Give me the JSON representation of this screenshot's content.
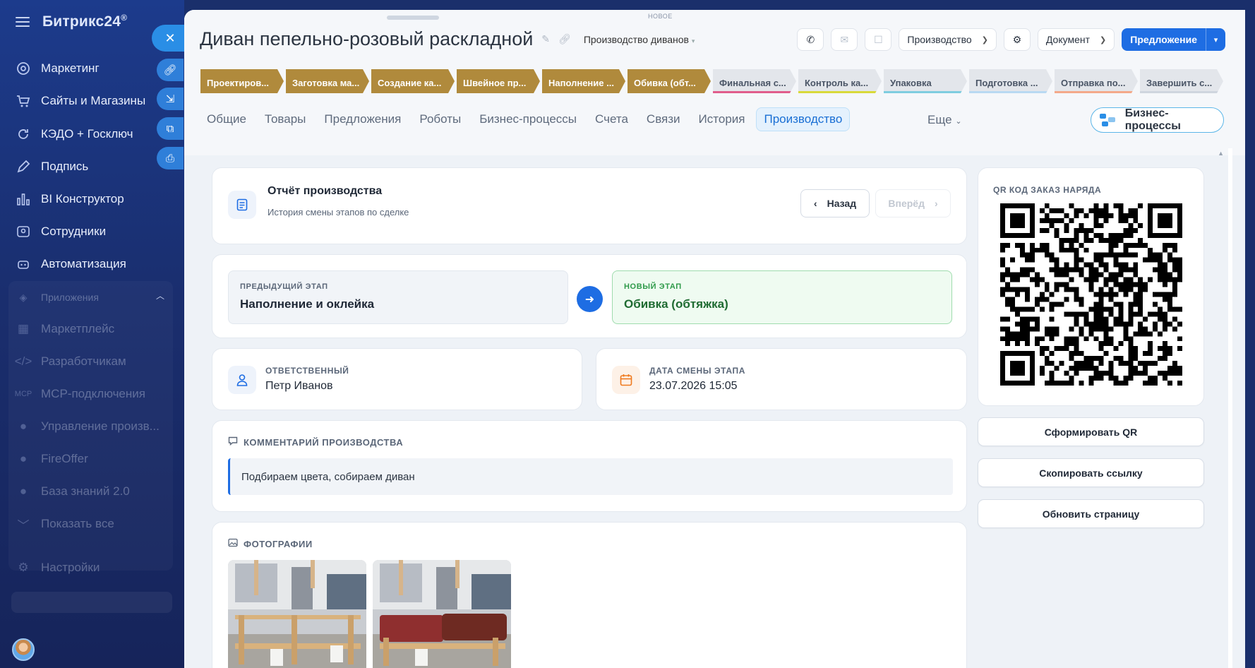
{
  "sidebar": {
    "logo": "Битрикс24",
    "logo_mark": "®",
    "items": [
      {
        "label": "Маркетинг",
        "icon": "target-icon"
      },
      {
        "label": "Сайты и Магазины",
        "icon": "cart-icon"
      },
      {
        "label": "КЭДО + Госключ",
        "icon": "refresh-icon"
      },
      {
        "label": "Подпись",
        "icon": "pen-icon"
      },
      {
        "label": "BI Конструктор",
        "icon": "chart-icon"
      },
      {
        "label": "Сотрудники",
        "icon": "users-icon"
      },
      {
        "label": "Автоматизация",
        "icon": "robot-icon"
      }
    ],
    "group_label": "Приложения",
    "group_items": [
      {
        "label": "Маркетплейс"
      },
      {
        "label": "Разработчикам"
      },
      {
        "label": "MCP-подключения"
      },
      {
        "label": "Управление произв..."
      },
      {
        "label": "FireOffer"
      },
      {
        "label": "База знаний 2.0"
      },
      {
        "label": "Показать все"
      }
    ],
    "settings_label": "Настройки"
  },
  "header": {
    "top_tag": "НОВОЕ",
    "title": "Диван пепельно-розовый раскладной",
    "pipeline": "Производство диванов",
    "dropdown_production": "Производство",
    "dropdown_document": "Документ",
    "primary_button": "Предложение"
  },
  "stages": [
    {
      "label": "Проектиров...",
      "state": "done"
    },
    {
      "label": "Заготовка ма...",
      "state": "done"
    },
    {
      "label": "Создание ка...",
      "state": "done"
    },
    {
      "label": "Швейное пр...",
      "state": "done"
    },
    {
      "label": "Наполнение ...",
      "state": "done"
    },
    {
      "label": "Обивка (обт...",
      "state": "done"
    },
    {
      "label": "Финальная с...",
      "state": "todo",
      "color": "#e05d8c"
    },
    {
      "label": "Контроль ка...",
      "state": "todo",
      "color": "#d9d93a"
    },
    {
      "label": "Упаковка",
      "state": "todo",
      "color": "#7fcde0"
    },
    {
      "label": "Подготовка ...",
      "state": "todo",
      "color": "#b9d9f2"
    },
    {
      "label": "Отправка по...",
      "state": "todo",
      "color": "#f4a98a"
    },
    {
      "label": "Завершить с...",
      "state": "todo",
      "color": "#cfd5de"
    }
  ],
  "tabs": [
    "Общие",
    "Товары",
    "Предложения",
    "Роботы",
    "Бизнес-процессы",
    "Счета",
    "Связи",
    "История",
    "Производство"
  ],
  "tabs_more": "Еще",
  "bp_button": "Бизнес-процессы",
  "report": {
    "title": "Отчёт производства",
    "subtitle": "История смены этапов по сделке",
    "back": "Назад",
    "next": "Вперёд"
  },
  "transition": {
    "prev_caption": "ПРЕДЫДУЩИЙ ЭТАП",
    "prev_value": "Наполнение и оклейка",
    "new_caption": "НОВЫЙ ЭТАП",
    "new_value": "Обивка (обтяжка)"
  },
  "responsible": {
    "caption": "ОТВЕТСТВЕННЫЙ",
    "value": "Петр Иванов"
  },
  "change_date": {
    "caption": "ДАТА СМЕНЫ ЭТАПА",
    "value": "23.07.2026 15:05"
  },
  "comment": {
    "caption": "КОММЕНТАРИЙ ПРОИЗВОДСТВА",
    "text": "Подбираем цвета, собираем диван"
  },
  "photos": {
    "caption": "ФОТОГРАФИИ",
    "count": 2
  },
  "qr": {
    "caption": "QR КОД ЗАКАЗ НАРЯДА",
    "buttons": [
      "Сформировать QR",
      "Скопировать ссылку",
      "Обновить страницу"
    ]
  },
  "colors": {
    "accent": "#1e6de3",
    "stage_done": "#b08a3c",
    "new_stage_bg": "#effbf1",
    "new_stage_text": "#1f7a34"
  }
}
